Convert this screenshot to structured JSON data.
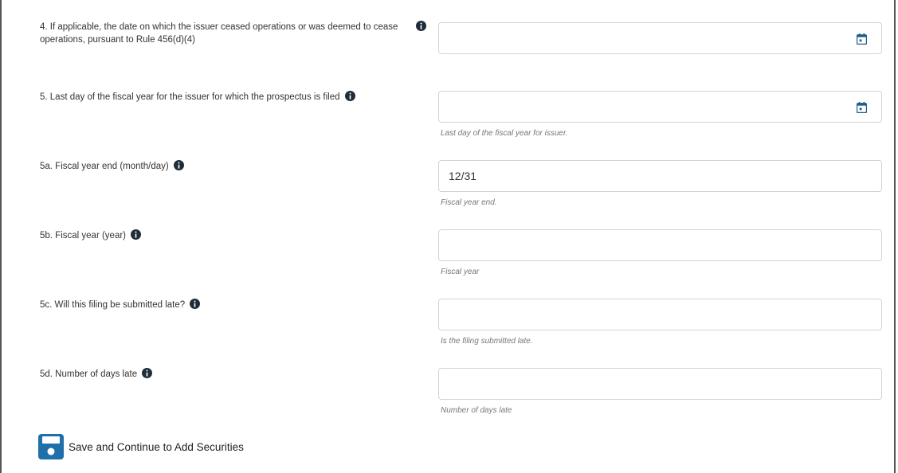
{
  "fields": [
    {
      "label": "4. If applicable, the date on which the issuer ceased operations or was deemed to cease operations, pursuant to Rule 456(d)(4)",
      "value": "",
      "hint": "",
      "icon": "calendar-icon"
    },
    {
      "label": "5. Last day of the fiscal year for the issuer for which the prospectus is filed",
      "value": "",
      "hint": "Last day of the fiscal year for issuer.",
      "icon": "calendar-icon"
    },
    {
      "label": "5a. Fiscal year end (month/day)",
      "value": "12/31",
      "hint": "Fiscal year end."
    },
    {
      "label": "5b. Fiscal year (year)",
      "value": "",
      "hint": "Fiscal year"
    },
    {
      "label": "5c. Will this filing be submitted late?",
      "value": "",
      "hint": "Is the filing submitted late."
    },
    {
      "label": "5d. Number of days late",
      "value": "",
      "hint": "Number of days late"
    }
  ],
  "save_button": {
    "label": "Save and Continue to Add Securities",
    "icon": "save-icon",
    "color": "#1f6fa8"
  },
  "colors": {
    "icon": "#1f5f8b",
    "hint": "#777777",
    "border": "#cfd4da"
  }
}
